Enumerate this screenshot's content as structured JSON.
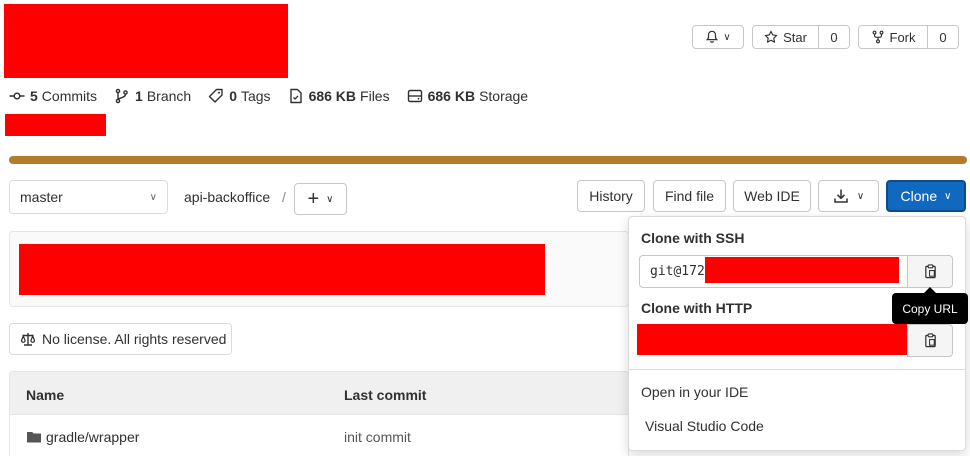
{
  "header": {
    "notifications_caret": "⌄",
    "star_label": "Star",
    "star_count": "0",
    "fork_label": "Fork",
    "fork_count": "0"
  },
  "stats": {
    "commits_value": "5",
    "commits_label": "Commits",
    "branch_value": "1",
    "branch_label": "Branch",
    "tags_value": "0",
    "tags_label": "Tags",
    "files_value": "686 KB",
    "files_label": "Files",
    "storage_value": "686 KB",
    "storage_label": "Storage"
  },
  "toolbar": {
    "branch": "master",
    "project_path": "api-backoffice",
    "path_separator": "/",
    "add_label": "+",
    "history_label": "History",
    "find_file_label": "Find file",
    "web_ide_label": "Web IDE",
    "clone_label": "Clone"
  },
  "license": {
    "text": "No license. All rights reserved"
  },
  "table": {
    "headers": [
      "Name",
      "Last commit"
    ],
    "rows": [
      {
        "name": "gradle/wrapper",
        "last_commit": "init commit"
      }
    ]
  },
  "clone_dropdown": {
    "ssh_title": "Clone with SSH",
    "ssh_value": "git@172",
    "http_title": "Clone with HTTP",
    "ide_title": "Open in your IDE",
    "ide_option": "Visual Studio Code",
    "tooltip": "Copy URL"
  },
  "colors": {
    "progress": "#b37b2a",
    "clone_button": "#1068bf",
    "redaction": "#ff0000"
  }
}
